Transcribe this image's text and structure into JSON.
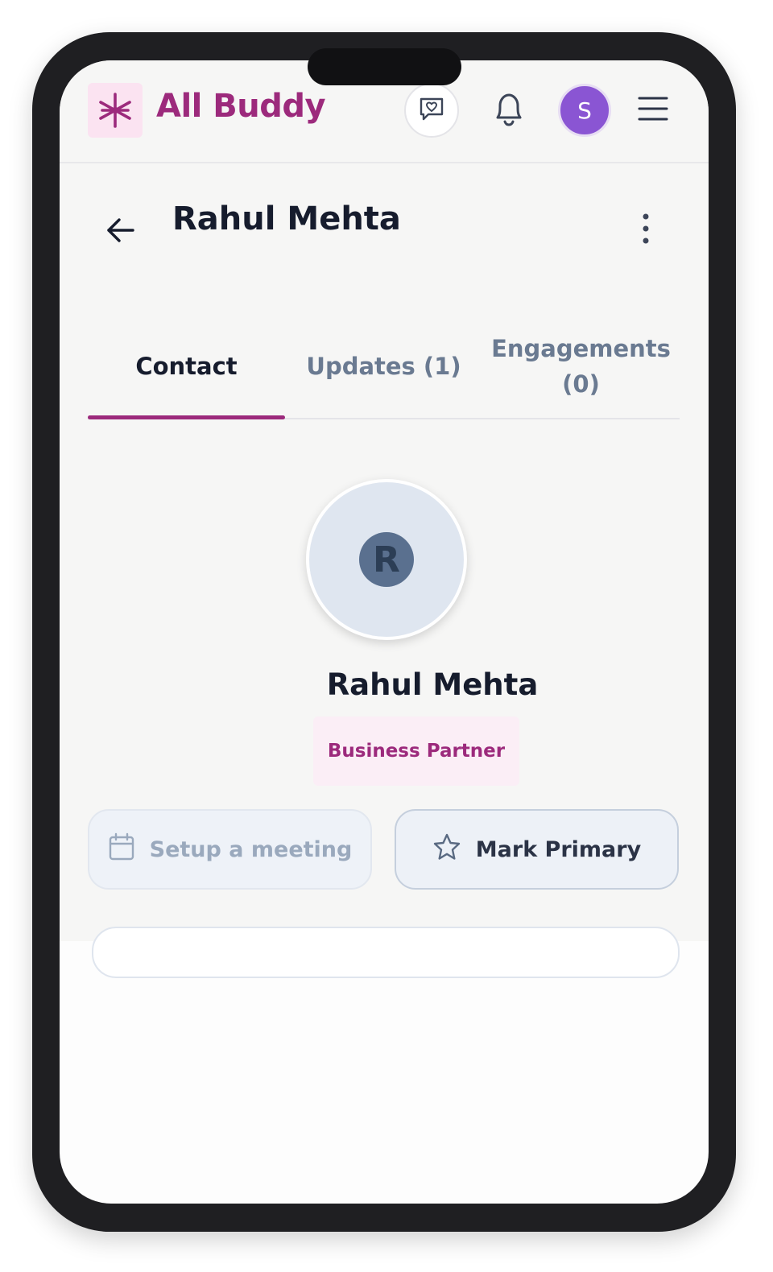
{
  "header": {
    "brand_name": "All Buddy",
    "avatar_initial": "S"
  },
  "page": {
    "title": "Rahul Mehta"
  },
  "tabs": [
    {
      "label": "Contact",
      "active": true
    },
    {
      "label": "Updates (1)",
      "active": false
    },
    {
      "label": "Engagements (0)",
      "active": false
    }
  ],
  "profile": {
    "initial": "R",
    "name": "Rahul Mehta",
    "role": "Business Partner"
  },
  "actions": {
    "setup_meeting_label": "Setup a meeting",
    "mark_primary_label": "Mark Primary"
  },
  "colors": {
    "brand": "#9c2a7c",
    "avatar": "#8a55d3",
    "text_dark": "#161c2d",
    "text_muted": "#6a7a91"
  },
  "icons": {
    "logo": "asterisk-logo-icon",
    "chat": "chat-heart-icon",
    "notifications": "bell-icon",
    "menu": "hamburger-menu-icon",
    "back": "arrow-left-icon",
    "more": "kebab-menu-icon",
    "meeting": "calendar-icon",
    "primary": "star-icon"
  }
}
